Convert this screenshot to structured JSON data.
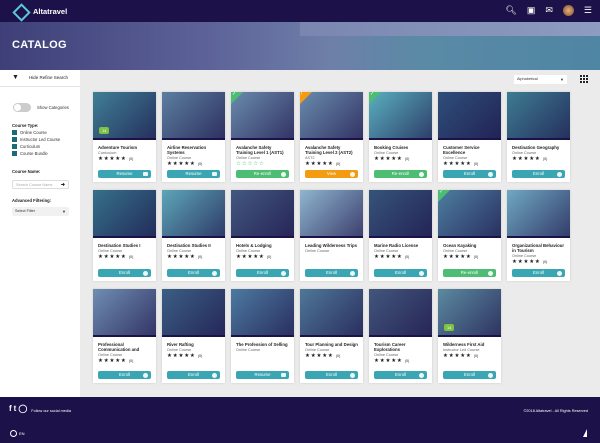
{
  "header": {
    "brand": "Altatravel",
    "icons": [
      "search-icon",
      "cart-icon",
      "mail-icon",
      "avatar",
      "menu-icon"
    ]
  },
  "banner": {
    "title": "CATALOG"
  },
  "toolbar": {
    "refine_label": "Hide Refine Search",
    "sort_value": "Alphabetical"
  },
  "sidebar": {
    "show_categories": "Show Categories",
    "course_type_label": "Course Type:",
    "course_types": [
      "Online Course",
      "Instructor Led Course",
      "Curriculum",
      "Course Bundle"
    ],
    "course_name_label": "Course Name:",
    "course_name_placeholder": "Search Course Name",
    "advanced_label": "Advanced Filtering:",
    "filter_value": "Select Filter"
  },
  "colors": {
    "navy": "#1c1148",
    "teal": "#3aa6b4",
    "green": "#4dbd74",
    "orange": "#f39c12"
  },
  "cards": [
    {
      "title": "Adventure Tourism",
      "type": "Curriculum",
      "rating": "(0)",
      "button": "Resume",
      "kind": "teal",
      "icon": "monitor",
      "pill": "14",
      "img": "#3f7f95"
    },
    {
      "title": "Airline Reservation Systems",
      "type": "Online Course",
      "rating": "(0)",
      "button": "Resume",
      "kind": "teal",
      "icon": "monitor",
      "img": "#5c7fa0"
    },
    {
      "title": "Avalanche Safety Training Level 1 (AST1)",
      "type": "Online Course",
      "rating": "",
      "button": "Re-enroll",
      "kind": "green",
      "badge": "check",
      "green_stars": true,
      "img": "#6a8bad"
    },
    {
      "title": "Avalanche Safety Training Level 2 (AST2)",
      "type": "AST2",
      "rating": "(0)",
      "button": "View",
      "kind": "orange",
      "badge": "warn",
      "img": "#6a8bad"
    },
    {
      "title": "Booking Cruises",
      "type": "Online Course",
      "rating": "(0)",
      "button": "Re-enroll",
      "kind": "green",
      "badge": "check",
      "img": "#5ab0bf"
    },
    {
      "title": "Customer Service Excellence",
      "type": "Online Course",
      "rating": "(0)",
      "button": "Enroll",
      "kind": "teal",
      "img": "#2f4f7a"
    },
    {
      "title": "Destination Geography",
      "type": "Online Course",
      "rating": "(0)",
      "button": "Enroll",
      "kind": "teal",
      "img": "#3d7c92"
    },
    {
      "title": "Destination Studies I",
      "type": "Online Course",
      "rating": "(0)",
      "button": "Enroll",
      "kind": "teal",
      "img": "#35718a"
    },
    {
      "title": "Destination Studies II",
      "type": "Online Course",
      "rating": "(0)",
      "button": "Enroll",
      "kind": "teal",
      "img": "#5da6b9"
    },
    {
      "title": "Hotels & Lodging",
      "type": "Online Course",
      "rating": "(0)",
      "button": "Enroll",
      "kind": "teal",
      "img": "#42587f"
    },
    {
      "title": "Leading Wilderness Trips",
      "type": "Online Course",
      "rating": null,
      "button": "Enroll",
      "kind": "teal",
      "img": "#8fb6cf"
    },
    {
      "title": "Marine Radio License",
      "type": "Online Course",
      "rating": "(0)",
      "button": "Enroll",
      "kind": "teal",
      "img": "#36547a"
    },
    {
      "title": "Ocean Kayaking",
      "type": "Online Course",
      "rating": "(0)",
      "button": "Re-enroll",
      "kind": "green",
      "badge": "check",
      "img": "#4d7ea0"
    },
    {
      "title": "Organizational Behaviour in Tourism",
      "type": "Online Course",
      "rating": "(0)",
      "button": "Enroll",
      "kind": "teal",
      "img": "#6fa9c2"
    },
    {
      "title": "Professional Communication and",
      "type": "Online Course",
      "rating": "(0)",
      "button": "Enroll",
      "kind": "teal",
      "img": "#6f8eb2"
    },
    {
      "title": "River Rafting",
      "type": "Online Course",
      "rating": "(0)",
      "button": "Enroll",
      "kind": "teal",
      "img": "#3b5f84"
    },
    {
      "title": "The Profession of Selling",
      "type": "Online Course",
      "rating": null,
      "button": "Resume",
      "kind": "teal",
      "icon": "monitor",
      "img": "#4c7aa0"
    },
    {
      "title": "Tour Planning and Design",
      "type": "Online Course",
      "rating": "(0)",
      "button": "Enroll",
      "kind": "teal",
      "img": "#4f7898"
    },
    {
      "title": "Tourism Career Explorations",
      "type": "Online Course",
      "rating": "(0)",
      "button": "Enroll",
      "kind": "teal",
      "img": "#42577c"
    },
    {
      "title": "Wilderness First Aid",
      "type": "Instructor Led Course",
      "rating": "(0)",
      "button": "Enroll",
      "kind": "teal",
      "pill": "14",
      "img": "#5b8aa0"
    }
  ],
  "footer": {
    "social_text": "Follow our social media",
    "copyright": "©2018 Altatravel - All Rights Reserved",
    "lang": "EN"
  }
}
